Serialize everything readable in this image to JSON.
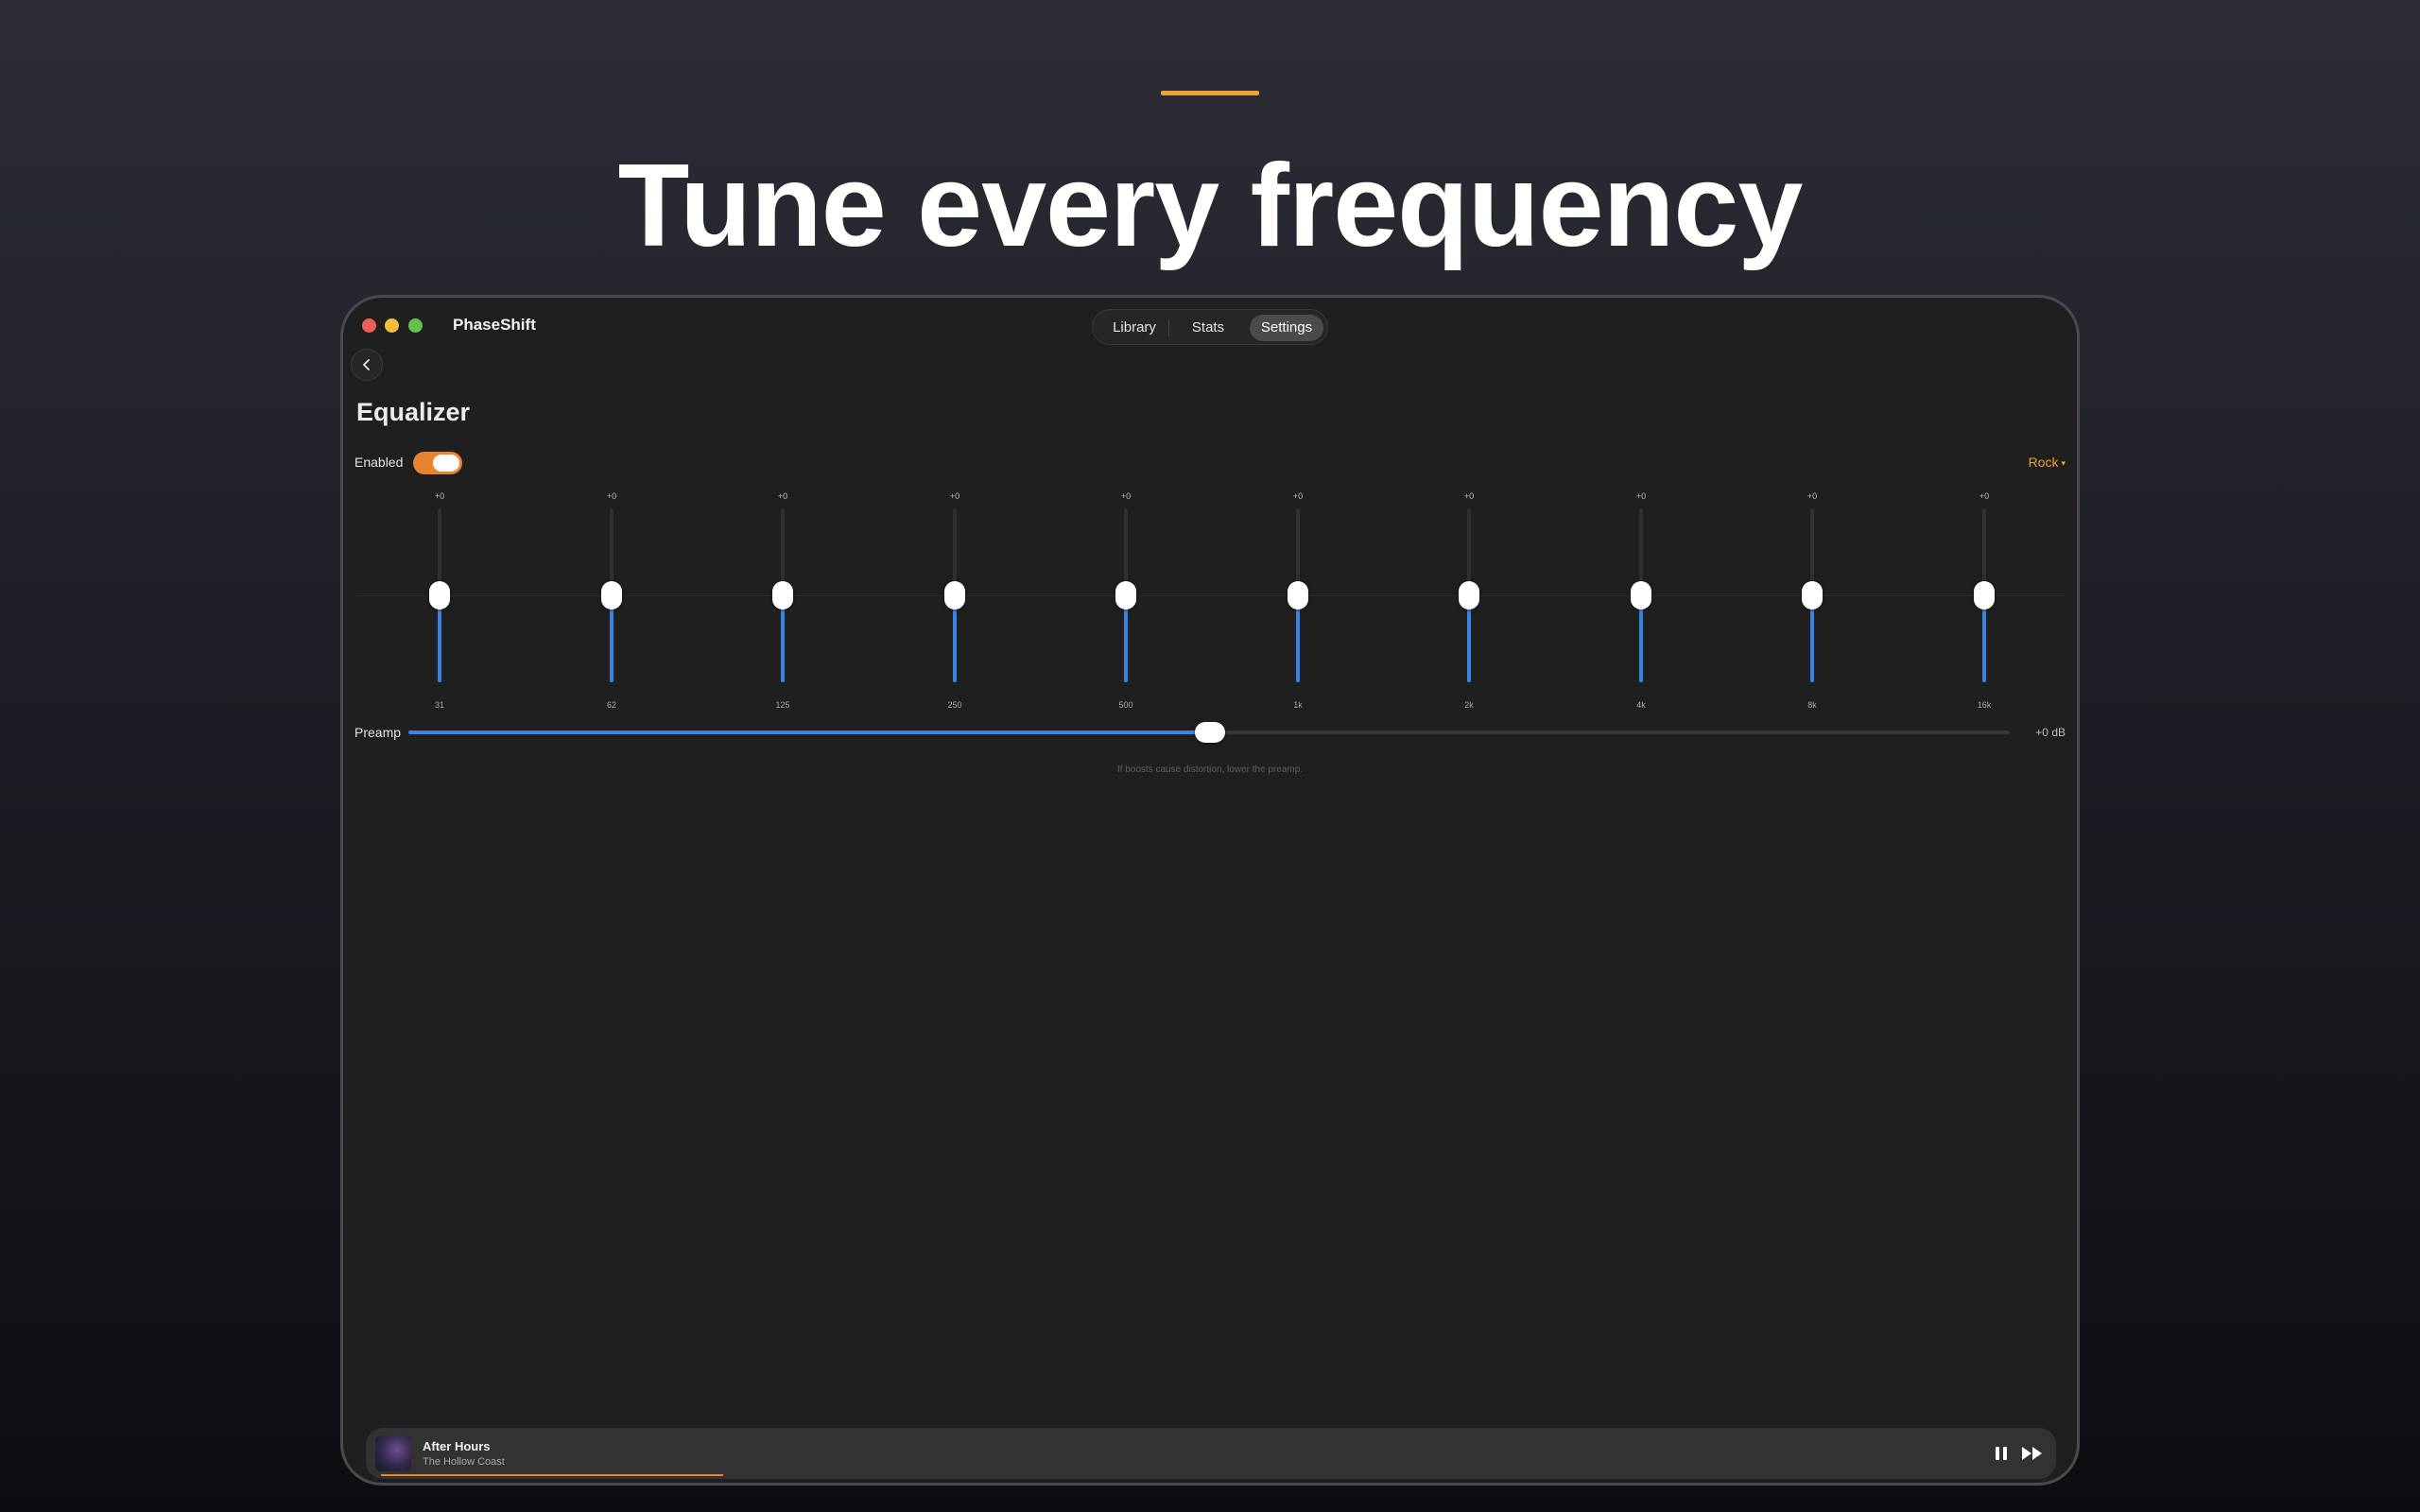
{
  "hero": {
    "title": "Tune every frequency"
  },
  "window": {
    "app_title": "PhaseShift",
    "tabs": [
      {
        "label": "Library",
        "selected": false
      },
      {
        "label": "Stats",
        "selected": false
      },
      {
        "label": "Settings",
        "selected": true
      }
    ]
  },
  "equalizer": {
    "title": "Equalizer",
    "enabled_label": "Enabled",
    "enabled": true,
    "preset": "Rock",
    "bands": [
      {
        "freq": "31",
        "gain": "+0"
      },
      {
        "freq": "62",
        "gain": "+0"
      },
      {
        "freq": "125",
        "gain": "+0"
      },
      {
        "freq": "250",
        "gain": "+0"
      },
      {
        "freq": "500",
        "gain": "+0"
      },
      {
        "freq": "1k",
        "gain": "+0"
      },
      {
        "freq": "2k",
        "gain": "+0"
      },
      {
        "freq": "4k",
        "gain": "+0"
      },
      {
        "freq": "8k",
        "gain": "+0"
      },
      {
        "freq": "16k",
        "gain": "+0"
      }
    ],
    "preamp_label": "Preamp",
    "preamp_value": "+0 dB",
    "hint": "If boosts cause distortion, lower the preamp."
  },
  "now_playing": {
    "title": "After Hours",
    "artist": "The Hollow Coast",
    "progress": 0.2
  },
  "colors": {
    "accent": "#e8832f",
    "slider": "#3b82e6",
    "preset": "#f0a030"
  }
}
